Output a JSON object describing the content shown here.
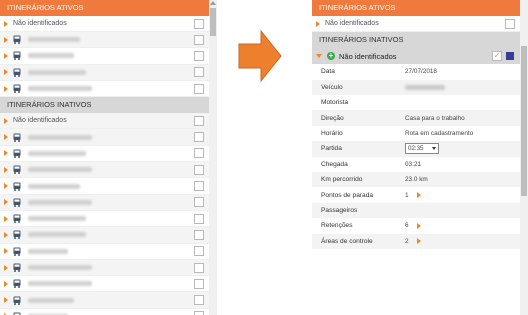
{
  "left": {
    "active_header": "ITINERÁRIOS ATIVOS",
    "active_unidentified": "Não identificados",
    "active_routes": [
      {
        "icon": "bus-icon",
        "label": "08810 - Cucuyanes"
      },
      {
        "icon": "bus-icon",
        "label": "08815 - Fazenda Grande III"
      },
      {
        "icon": "bus-icon",
        "label": "08877 - Imbui"
      },
      {
        "icon": "bus-icon",
        "label": "08898 - Santa Maria"
      }
    ],
    "inactive_header": "ITINERÁRIOS INATIVOS",
    "inactive_unidentified": "Não identificados",
    "inactive_routes": [
      {
        "icon": "bus-icon",
        "label": "15001 - Cabula"
      },
      {
        "icon": "bus-icon",
        "label": "14402 - Barra"
      },
      {
        "icon": "bus-icon",
        "label": "14404 - Bonfim"
      },
      {
        "icon": "bus-icon",
        "label": "14409 - Liberdade"
      },
      {
        "icon": "bus-icon",
        "label": "14409 - Brotas"
      },
      {
        "icon": "bus-icon",
        "label": "10407 - Mirantes de Periperi"
      },
      {
        "icon": "bus-icon",
        "label": "10408 - Rio de São João"
      },
      {
        "icon": "bus-icon",
        "label": "10410 - Santo Inácio"
      },
      {
        "icon": "bus-icon",
        "label": "10411 - São Caetano"
      },
      {
        "icon": "bus-icon",
        "label": "10412 - Pituba"
      },
      {
        "icon": "bus-icon",
        "label": "10414 - Fazenda Grande III"
      },
      {
        "icon": "bus-icon",
        "label": "10415 - Trobogy"
      }
    ]
  },
  "right": {
    "active_header": "ITINERÁRIOS ATIVOS",
    "active_unidentified": "Não identificados",
    "inactive_header": "ITINERÁRIOS INATIVOS",
    "detail_title": "Não identificados",
    "check_mark": "✓",
    "route_color": "#3b3b98",
    "fields": {
      "data_label": "Data",
      "data_value": "27/07/2018",
      "veiculo_label": "Veículo",
      "veiculo_value": "OZA 4839 XS047",
      "motorista_label": "Motorista",
      "motorista_value": "",
      "direcao_label": "Direção",
      "direcao_value": "Casa para o trabalho",
      "horario_label": "Horário",
      "horario_value": "Rota em cadastramento",
      "partida_label": "Partida",
      "partida_value": "02:35",
      "chegada_label": "Chegada",
      "chegada_value": "03:21",
      "km_label": "Km percorrido",
      "km_value": "23.0 km",
      "pontos_label": "Pontos de parada",
      "pontos_value": "1",
      "passageiros_label": "Passageiros",
      "passageiros_value": "",
      "retencoes_label": "Retenções",
      "retencoes_value": "6",
      "areas_label": "Áreas de controle",
      "areas_value": "2"
    }
  },
  "colors": {
    "accent": "#f07a3e",
    "section_gray": "#d7d7d7",
    "arrow": "#ee7f2d"
  }
}
